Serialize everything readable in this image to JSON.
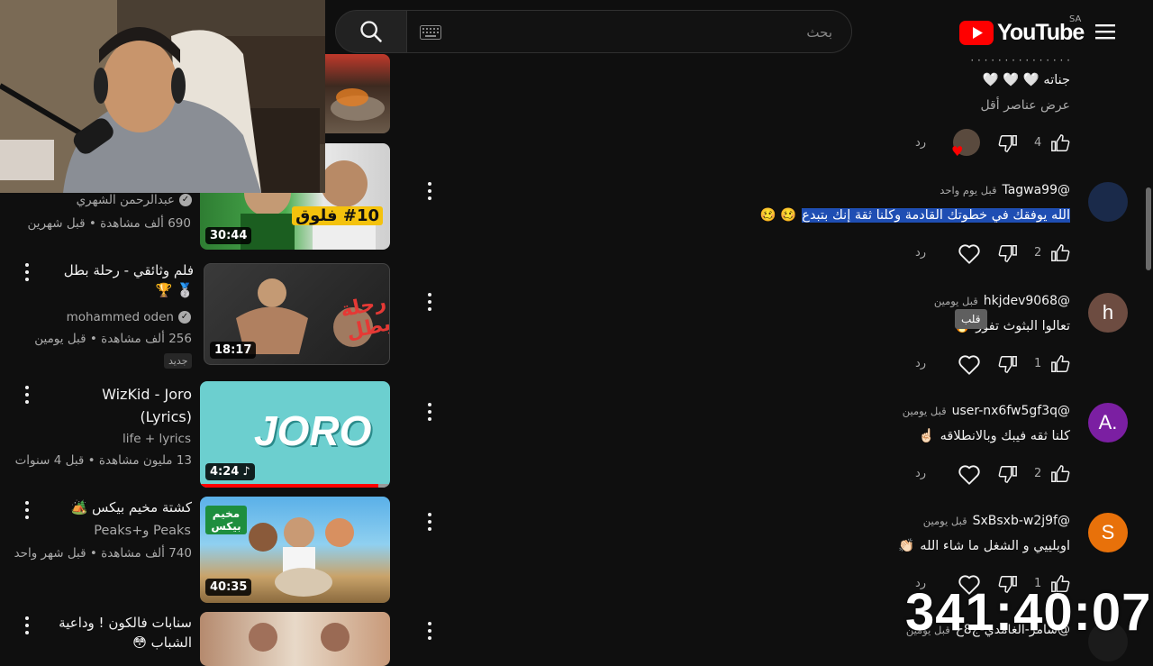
{
  "header": {
    "search_placeholder": "بحث",
    "logo_text": "YouTube",
    "region": "SA"
  },
  "recommendations": [
    {
      "title": "",
      "channel": "عبدالرحمن الشهري",
      "meta": "690 ألف مشاهدة • قبل شهرين",
      "duration": "30:44",
      "thumb_caption": "#10 فلوق"
    },
    {
      "title": "فلم وثائقي - رحلة بطل 🥈 🏆",
      "channel": "mohammed oden",
      "meta": "256 ألف مشاهدة • قبل يومين",
      "badge": "جديد",
      "duration": "18:17",
      "thumb_caption": "رحلة بطل"
    },
    {
      "title": "WizKid - Joro (Lyrics)",
      "channel": "life + lyrics",
      "meta": "13 مليون مشاهدة • قبل 4 سنوات",
      "duration": "4:24",
      "thumb_caption": "JORO"
    },
    {
      "title": "كشتة مخيم بيكس 🏕️",
      "channel": "Peaks و+Peaks",
      "meta": "740 ألف مشاهدة • قبل شهر واحد",
      "duration": "40:35",
      "thumb_caption": "مخيم بيكس"
    },
    {
      "title": "سنابات فالكون ! وداعية الشباب 😳",
      "channel": "",
      "meta": "",
      "duration": "",
      "thumb_caption": ""
    }
  ],
  "comments": {
    "partial": {
      "text": "جناته 🤍 🤍 🤍",
      "show_less": "عرض عناصر أقل",
      "likes": "4",
      "reply": "رد"
    },
    "items": [
      {
        "author": "@Tagwa99",
        "time": "قبل يوم واحد",
        "text": "الله يوفقك في خطوتك القادمة وكلنا ثقة إنك بتبدع",
        "emoji": "🥴 🥴",
        "likes": "2",
        "reply": "رد",
        "avatar_letter": "",
        "avatar_color": "#1a2a4a"
      },
      {
        "author": "@hkjdev9068",
        "time": "قبل يومين",
        "text": "تعالوا البثوث تفوز",
        "emoji": "🔥",
        "likes": "1",
        "reply": "رد",
        "avatar_letter": "h",
        "avatar_color": "#6d4c41",
        "tooltip": "قلب"
      },
      {
        "author": "@user-nx6fw5gf3q",
        "time": "قبل يومين",
        "text": "كلنا ثقه فيبك وبالانطلاقه",
        "emoji": "☝🏻",
        "likes": "2",
        "reply": "رد",
        "avatar_letter": "A.",
        "avatar_color": "#7b1fa2"
      },
      {
        "author": "@SxBsxb-w2j9f",
        "time": "قبل يومين",
        "text": "اوبلييي و الشغل ما شاء الله",
        "emoji": "👏🏻",
        "likes": "1",
        "reply": "رد",
        "avatar_letter": "S",
        "avatar_color": "#e8710a"
      },
      {
        "author": "@سامر-الغامدي-ج8ح",
        "time": "قبل يومين",
        "text": "",
        "emoji": "",
        "likes": "",
        "reply": "",
        "avatar_letter": "",
        "avatar_color": "#1b1b1b"
      }
    ]
  },
  "overlay": {
    "timer": "341:40:07"
  },
  "colors": {
    "background": "#0f0f0f",
    "accent_red": "#ff0000",
    "selection": "#1f4eb3"
  }
}
